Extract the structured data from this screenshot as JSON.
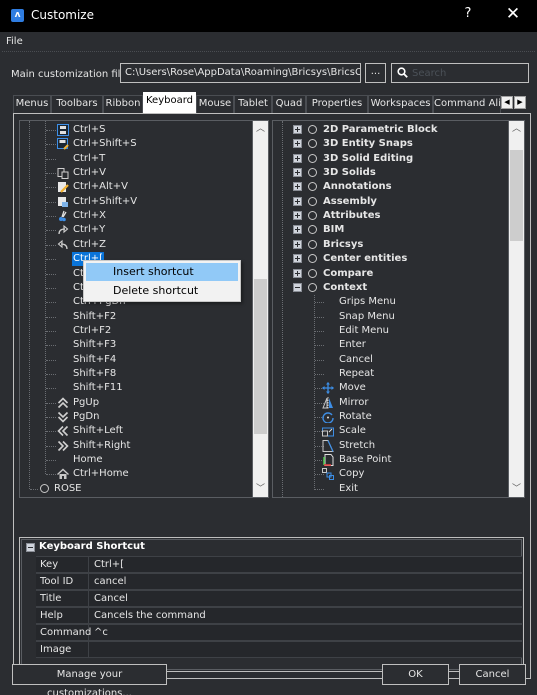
{
  "window": {
    "title": "Customize",
    "app_icon": "bricscad-logo-icon",
    "help_label": "?",
    "close_label": "✕"
  },
  "menubar": {
    "file_label": "File"
  },
  "file": {
    "label": "Main customization file:",
    "path": "C:\\Users\\Rose\\AppData\\Roaming\\Bricsys\\BricsCAD",
    "browse_label": "...",
    "search_placeholder": "Search",
    "search_value": ""
  },
  "tabs": [
    {
      "label": "Menus",
      "active": false
    },
    {
      "label": "Toolbars",
      "active": false
    },
    {
      "label": "Ribbon",
      "active": false
    },
    {
      "label": "Keyboard",
      "active": true
    },
    {
      "label": "Mouse",
      "active": false
    },
    {
      "label": "Tablet",
      "active": false
    },
    {
      "label": "Quad",
      "active": false
    },
    {
      "label": "Properties",
      "active": false
    },
    {
      "label": "Workspaces",
      "active": false
    },
    {
      "label": "Command Ali",
      "active": false
    }
  ],
  "tab_scroll": {
    "left": "◀",
    "right": "▶"
  },
  "left_tree": {
    "items": [
      {
        "label": "Ctrl+S",
        "icon": "save-icon"
      },
      {
        "label": "Ctrl+Shift+S",
        "icon": "save-as-icon"
      },
      {
        "label": "Ctrl+T",
        "icon": ""
      },
      {
        "label": "Ctrl+V",
        "icon": "paste-icon"
      },
      {
        "label": "Ctrl+Alt+V",
        "icon": "paste-special-icon"
      },
      {
        "label": "Ctrl+Shift+V",
        "icon": "paste-block-icon"
      },
      {
        "label": "Ctrl+X",
        "icon": "cut-icon"
      },
      {
        "label": "Ctrl+Y",
        "icon": "redo-icon"
      },
      {
        "label": "Ctrl+Z",
        "icon": "undo-icon"
      },
      {
        "label": "Ctrl+[",
        "icon": "",
        "selected": true
      },
      {
        "label": "Ctrl",
        "icon": ""
      },
      {
        "label": "Ctrl",
        "icon": ""
      },
      {
        "label": "Ctrl+PgDn",
        "icon": ""
      },
      {
        "label": "Shift+F2",
        "icon": ""
      },
      {
        "label": "Ctrl+F2",
        "icon": ""
      },
      {
        "label": "Shift+F3",
        "icon": ""
      },
      {
        "label": "Shift+F4",
        "icon": ""
      },
      {
        "label": "Shift+F8",
        "icon": ""
      },
      {
        "label": "Shift+F11",
        "icon": ""
      },
      {
        "label": "PgUp",
        "icon": "page-up-icon"
      },
      {
        "label": "PgDn",
        "icon": "page-down-icon"
      },
      {
        "label": "Shift+Left",
        "icon": "double-left-icon"
      },
      {
        "label": "Shift+Right",
        "icon": "double-right-icon"
      },
      {
        "label": "Home",
        "icon": ""
      },
      {
        "label": "Ctrl+Home",
        "icon": "home-icon"
      }
    ],
    "root_item": {
      "label": "ROSE"
    },
    "scroll_position": 0.75
  },
  "context_menu": {
    "items": [
      {
        "label": "Insert shortcut",
        "highlighted": true
      },
      {
        "label": "Delete shortcut",
        "highlighted": false
      }
    ]
  },
  "right_tree": {
    "groups": [
      {
        "label": "2D Parametric Block",
        "expanded": false
      },
      {
        "label": "3D Entity Snaps",
        "expanded": false
      },
      {
        "label": "3D Solid Editing",
        "expanded": false
      },
      {
        "label": "3D Solids",
        "expanded": false
      },
      {
        "label": "Annotations",
        "expanded": false
      },
      {
        "label": "Assembly",
        "expanded": false
      },
      {
        "label": "Attributes",
        "expanded": false
      },
      {
        "label": "BIM",
        "expanded": false
      },
      {
        "label": "Bricsys",
        "expanded": false
      },
      {
        "label": "Center entities",
        "expanded": false
      },
      {
        "label": "Compare",
        "expanded": false
      },
      {
        "label": "Context",
        "expanded": true
      }
    ],
    "context_children": [
      {
        "label": "Grips Menu",
        "icon": ""
      },
      {
        "label": "Snap Menu",
        "icon": ""
      },
      {
        "label": "Edit Menu",
        "icon": ""
      },
      {
        "label": "Enter",
        "icon": ""
      },
      {
        "label": "Cancel",
        "icon": ""
      },
      {
        "label": "Repeat",
        "icon": ""
      },
      {
        "label": "Move",
        "icon": "move-icon"
      },
      {
        "label": "Mirror",
        "icon": "mirror-icon"
      },
      {
        "label": "Rotate",
        "icon": "rotate-icon"
      },
      {
        "label": "Scale",
        "icon": "scale-icon"
      },
      {
        "label": "Stretch",
        "icon": "stretch-icon"
      },
      {
        "label": "Base Point",
        "icon": "base-point-icon"
      },
      {
        "label": "Copy",
        "icon": "copy-icon"
      },
      {
        "label": "Exit",
        "icon": ""
      }
    ],
    "scroll_position": 0.05
  },
  "properties": {
    "title": "Keyboard Shortcut",
    "rows": [
      {
        "key": "Key",
        "value": "Ctrl+["
      },
      {
        "key": "Tool ID",
        "value": "cancel"
      },
      {
        "key": "Title",
        "value": "Cancel"
      },
      {
        "key": "Help",
        "value": "Cancels the command"
      },
      {
        "key": "Command",
        "value": "^c"
      },
      {
        "key": "Image",
        "value": ""
      }
    ]
  },
  "buttons": {
    "manage": "Manage your customizations...",
    "ok": "OK",
    "cancel": "Cancel"
  },
  "colors": {
    "selection": "#0a74d9",
    "menu_hover": "#91c9f7",
    "background": "#2b2d31",
    "titlebar": "#000000"
  }
}
